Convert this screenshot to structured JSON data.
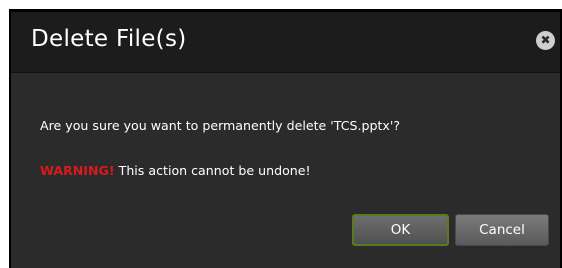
{
  "dialog": {
    "title": "Delete File(s)",
    "close_glyph": "✖",
    "message": "Are you sure you want to permanently delete 'TCS.pptx'?",
    "warning_label": "WARNING!",
    "warning_text": " This action cannot be undone!",
    "ok_label": "OK",
    "cancel_label": "Cancel"
  },
  "colors": {
    "warning": "#d71a1a",
    "ok_border": "#5a7a22",
    "background": "#2b2b2b"
  },
  "icons": {
    "close": "close-icon"
  }
}
